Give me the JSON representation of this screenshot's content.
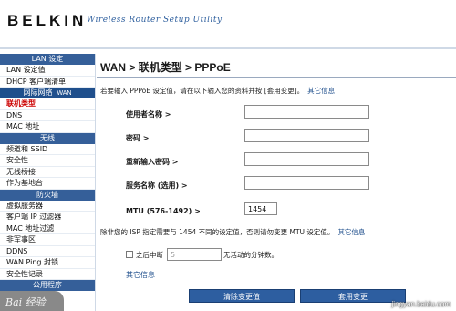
{
  "header": {
    "brand": "BELKIN",
    "tagline": "Wireless Router Setup Utility"
  },
  "sidebar": {
    "sections": [
      {
        "title": "LAN 设定",
        "items": [
          "LAN 设定值",
          "DHCP 客户端清单"
        ]
      },
      {
        "title": "网际网络",
        "title_en": "WAN",
        "active": true,
        "items": [
          "联机类型",
          "DNS",
          "MAC 地址"
        ]
      },
      {
        "title": "无线",
        "items": [
          "频道和 SSID",
          "安全性",
          "无线桥接",
          "作为基地台"
        ]
      },
      {
        "title": "防火墙",
        "items": [
          "虚拟服务器",
          "客户端 IP 过滤器",
          "MAC 地址过滤",
          "非军事区",
          "DDNS",
          "WAN Ping 封锁",
          "安全性记录"
        ]
      }
    ],
    "current_item": "联机类型",
    "cut_item": "公用程序"
  },
  "main": {
    "title": "WAN > 联机类型 > PPPoE",
    "intro": "若要输入 PPPoE 设定值，请在以下输入您的资料并按 [套用变更]。",
    "intro_link": "其它信息",
    "fields": {
      "username_label": "使用者名称 >",
      "username_value": "",
      "password_label": "密码 >",
      "password_value": "",
      "retype_label": "重新输入密码 >",
      "retype_value": "",
      "service_label": "服务名称 (选用) >",
      "service_value": "",
      "mtu_label": "MTU (576-1492) >",
      "mtu_value": "1454"
    },
    "note": "除非您的 ISP 指定需要与 1454 不同的设定值，否则请勿变更 MTU 设定值。",
    "note_link": "其它信息",
    "idle": {
      "checkbox_checked": false,
      "prefix": "之后中断",
      "minutes_value": "5",
      "suffix": "无活动的分钟数。"
    },
    "more_info": "其它信息",
    "buttons": {
      "clear": "清除变更值",
      "apply": "套用变更"
    }
  },
  "watermark": {
    "text": "jingyan.baidu.com",
    "badge": "Bai 经验"
  },
  "colors": {
    "nav_header": "#355f99",
    "link": "#1f4f8c",
    "button": "#2d5ea0",
    "current_item": "#cc0000"
  }
}
